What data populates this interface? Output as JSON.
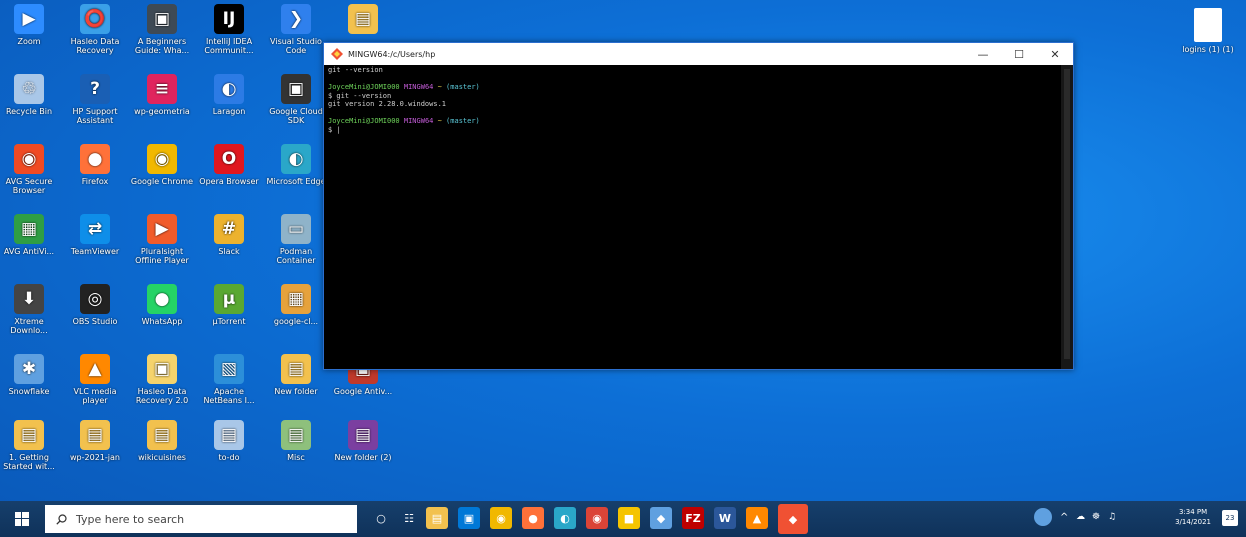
{
  "desktop": {
    "icons": [
      {
        "label": "Zoom",
        "glyph": "▶",
        "color": "#2d8cff"
      },
      {
        "label": "Hasleo Data Recovery",
        "glyph": "⭕",
        "color": "#3aa0e8"
      },
      {
        "label": "A Beginners Guide: Wha...",
        "glyph": "▣",
        "color": "#3e4a55"
      },
      {
        "label": "IntelliJ IDEA Communit...",
        "glyph": "IJ",
        "color": "#000000"
      },
      {
        "label": "Visual Studio Code",
        "glyph": "❯",
        "color": "#2f80ed"
      },
      {
        "label": "",
        "glyph": "▤",
        "color": "#f2c14e"
      },
      {
        "label": "Recycle Bin",
        "glyph": "♲",
        "color": "#a9c7e8"
      },
      {
        "label": "HP Support Assistant",
        "glyph": "?",
        "color": "#1a5fb4"
      },
      {
        "label": "wp-geometria",
        "glyph": "≡",
        "color": "#e0245e"
      },
      {
        "label": "Laragon",
        "glyph": "◐",
        "color": "#2c7be5"
      },
      {
        "label": "Google Cloud SDK",
        "glyph": "▣",
        "color": "#333333"
      },
      {
        "label": "AVG Secure Browser",
        "glyph": "◉",
        "color": "#f04a23"
      },
      {
        "label": "Firefox",
        "glyph": "●",
        "color": "#ff7139"
      },
      {
        "label": "Google Chrome",
        "glyph": "◉",
        "color": "#f1b800"
      },
      {
        "label": "Opera Browser",
        "glyph": "O",
        "color": "#e0171f"
      },
      {
        "label": "Microsoft Edge",
        "glyph": "◐",
        "color": "#2aa7c9"
      },
      {
        "label": "AVG AntiVi...",
        "glyph": "▦",
        "color": "#2f9e44"
      },
      {
        "label": "TeamViewer",
        "glyph": "⇄",
        "color": "#0e8ee9"
      },
      {
        "label": "Pluralsight Offline Player",
        "glyph": "▶",
        "color": "#f15b2a"
      },
      {
        "label": "Slack",
        "glyph": "#",
        "color": "#ecb22e"
      },
      {
        "label": "Podman Container",
        "glyph": "▭",
        "color": "#8fb3c9"
      },
      {
        "label": "Xtreme Downlo...",
        "glyph": "⬇",
        "color": "#444444"
      },
      {
        "label": "OBS Studio",
        "glyph": "◎",
        "color": "#222222"
      },
      {
        "label": "WhatsApp",
        "glyph": "●",
        "color": "#25d366"
      },
      {
        "label": "µTorrent",
        "glyph": "µ",
        "color": "#5aa832"
      },
      {
        "label": "google-cl...",
        "glyph": "▦",
        "color": "#e6a23c"
      },
      {
        "label": "Snowflake",
        "glyph": "✱",
        "color": "#5fa0e0"
      },
      {
        "label": "VLC media player",
        "glyph": "▲",
        "color": "#ff8800"
      },
      {
        "label": "Hasleo Data Recovery 2.0",
        "glyph": "▣",
        "color": "#f5d36c"
      },
      {
        "label": "Apache NetBeans I...",
        "glyph": "▧",
        "color": "#2c8fd9"
      },
      {
        "label": "New folder",
        "glyph": "▤",
        "color": "#f2c14e"
      },
      {
        "label": "Google Antiv...",
        "glyph": "▣",
        "color": "#c0392b"
      },
      {
        "label": "1. Getting Started wit...",
        "glyph": "▤",
        "color": "#f2c14e"
      },
      {
        "label": "wp-2021-jan",
        "glyph": "▤",
        "color": "#f2c14e"
      },
      {
        "label": "wikicuisines",
        "glyph": "▤",
        "color": "#f2c14e"
      },
      {
        "label": "to-do",
        "glyph": "▤",
        "color": "#a9c7e8"
      },
      {
        "label": "Misc",
        "glyph": "▤",
        "color": "#8ec07c"
      },
      {
        "label": "New folder (2)",
        "glyph": "▤",
        "color": "#7b3fa0"
      }
    ],
    "right_file": {
      "label": "logins (1) (1)"
    }
  },
  "terminal": {
    "title": "MINGW64:/c/Users/hp",
    "controls": {
      "minimize": "—",
      "maximize": "☐",
      "close": "✕"
    },
    "lines": [
      {
        "text": "git --version",
        "kind": "plain"
      },
      {
        "text": "",
        "kind": "plain"
      },
      {
        "user": "JoyceMini@JOMI000",
        "env": "MINGW64",
        "path": "~",
        "branch": "(master)",
        "kind": "prompt"
      },
      {
        "text": "$ git --version",
        "kind": "plain"
      },
      {
        "text": "git version 2.28.0.windows.1",
        "kind": "plain"
      },
      {
        "text": "",
        "kind": "plain"
      },
      {
        "user": "JoyceMini@JOMI000",
        "env": "MINGW64",
        "path": "~",
        "branch": "(master)",
        "kind": "prompt"
      },
      {
        "text": "$ |",
        "kind": "plain"
      }
    ]
  },
  "taskbar": {
    "search_placeholder": "Type here to search",
    "pinned": [
      {
        "name": "cortana",
        "glyph": "○",
        "color": "transparent"
      },
      {
        "name": "task-view",
        "glyph": "☷",
        "color": "transparent"
      },
      {
        "name": "file-explorer",
        "glyph": "▤",
        "color": "#f2c14e"
      },
      {
        "name": "store",
        "glyph": "▣",
        "color": "#0078d7"
      },
      {
        "name": "chrome",
        "glyph": "◉",
        "color": "#f1b800"
      },
      {
        "name": "firefox",
        "glyph": "●",
        "color": "#ff7139"
      },
      {
        "name": "edge",
        "glyph": "◐",
        "color": "#2aa7c9"
      },
      {
        "name": "chrome-2",
        "glyph": "◉",
        "color": "#db4437"
      },
      {
        "name": "sticky",
        "glyph": "■",
        "color": "#f5c400"
      },
      {
        "name": "app-blue",
        "glyph": "◆",
        "color": "#5fa0e0"
      },
      {
        "name": "filezilla",
        "glyph": "FZ",
        "color": "#bf0000"
      },
      {
        "name": "word",
        "glyph": "W",
        "color": "#2b579a"
      },
      {
        "name": "vlc",
        "glyph": "▲",
        "color": "#ff8800"
      },
      {
        "name": "git-bash",
        "glyph": "◆",
        "color": "#f05133"
      }
    ],
    "time": "3:34 PM",
    "date": "3/14/2021",
    "notification_count": "23"
  }
}
